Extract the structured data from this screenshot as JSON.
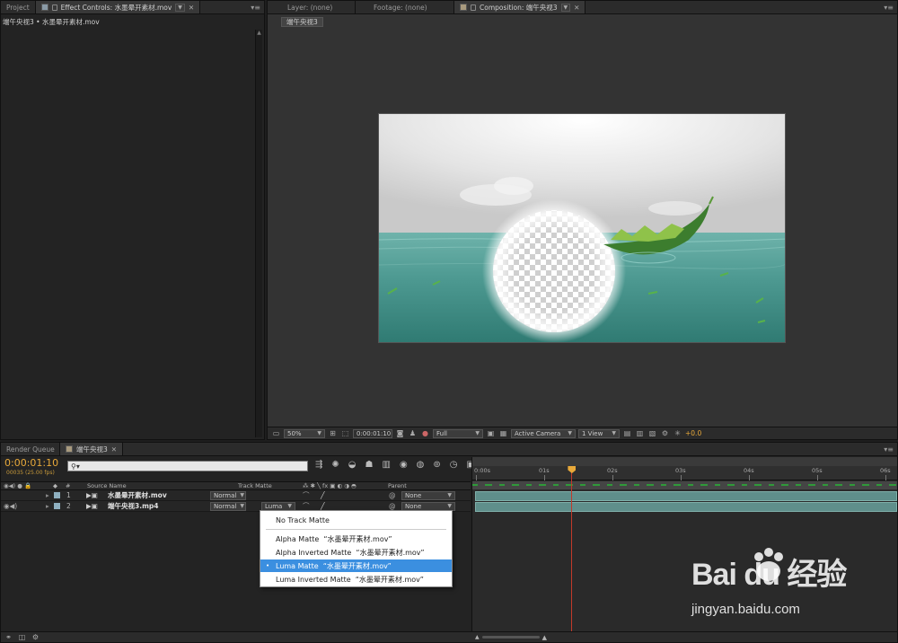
{
  "left_panel": {
    "tabs": [
      "Project",
      "Effect Controls: 水墨晕开素材.mov"
    ],
    "breadcrumb": "端午央视3 • 水墨晕开素材.mov"
  },
  "viewer_panel": {
    "tabs": [
      "Layer: (none)",
      "Footage: (none)",
      "Composition: 端午央视3"
    ],
    "comp_chip": "端午央视3",
    "bottom_bar": {
      "zoom": "50%",
      "timecode": "0:00:01:10",
      "resolution": "Full",
      "camera": "Active Camera",
      "views": "1 View",
      "exposure": "+0.0"
    }
  },
  "timeline": {
    "tabs": [
      "Render Queue",
      "端午央视3"
    ],
    "timecode": "0:00:01:10",
    "frame_info": "00035 (25.00 fps)",
    "search_placeholder": "",
    "columns": {
      "num": "#",
      "source_name": "Source Name",
      "track_matte": "Track Matte",
      "parent": "Parent"
    },
    "layers": [
      {
        "num": "1",
        "name": "水墨晕开素材.mov",
        "mode": "Normal",
        "track_matte": "",
        "parent": "None"
      },
      {
        "num": "2",
        "name": "端午央视3.mp4",
        "mode": "Normal",
        "track_matte": "Luma",
        "parent": "None"
      }
    ],
    "ruler_labels": [
      "0:00s",
      "01s",
      "02s",
      "03s",
      "04s",
      "05s",
      "06s"
    ],
    "playhead_seconds": 1.4
  },
  "track_matte_menu": {
    "items": [
      {
        "label": "No Track Matte",
        "selected": false
      },
      {
        "label": "Alpha Matte  “水墨晕开素材.mov”",
        "selected": false
      },
      {
        "label": "Alpha Inverted Matte  “水墨晕开素材.mov”",
        "selected": false
      },
      {
        "label": "Luma Matte  “水墨晕开素材.mov”",
        "selected": true
      },
      {
        "label": "Luma Inverted Matte  “水墨晕开素材.mov”",
        "selected": false
      }
    ]
  },
  "watermark": {
    "brand": "Bai du 经验",
    "url": "jingyan.baidu.com"
  },
  "colors": {
    "accent_timecode": "#e8a93a",
    "menu_selected": "#3b8fe0",
    "playhead": "#c23a2a",
    "layer_bar": "#5f8f8b",
    "keyframe": "#2f9a3a"
  }
}
